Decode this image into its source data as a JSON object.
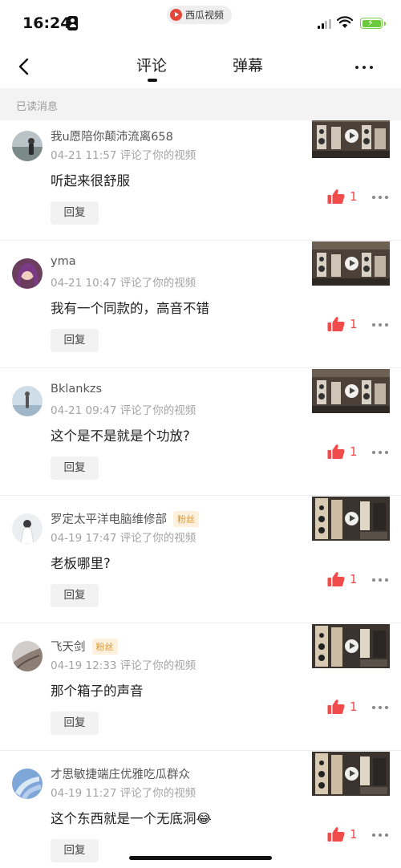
{
  "status_bar": {
    "time": "16:24",
    "app_name": "西瓜视频"
  },
  "nav": {
    "tabs": [
      {
        "label": "评论",
        "active": true
      },
      {
        "label": "弹幕",
        "active": false
      }
    ]
  },
  "section_header": "已读消息",
  "comments": [
    {
      "username": "我u愿陪你颠沛流离658",
      "badge": "",
      "meta": "04-21 11:57 评论了你的视频",
      "text": "听起来很舒服",
      "reply_label": "回复",
      "likes": "1"
    },
    {
      "username": "yma",
      "badge": "",
      "meta": "04-21 10:47 评论了你的视频",
      "text": "我有一个同款的，高音不错",
      "reply_label": "回复",
      "likes": "1"
    },
    {
      "username": "Bklankzs",
      "badge": "",
      "meta": "04-21 09:47 评论了你的视频",
      "text": "这个是不是就是个功放?",
      "reply_label": "回复",
      "likes": "1"
    },
    {
      "username": "罗定太平洋电脑维修部",
      "badge": "粉丝",
      "meta": "04-19 17:47 评论了你的视频",
      "text": "老板哪里?",
      "reply_label": "回复",
      "likes": "1"
    },
    {
      "username": "飞天剑",
      "badge": "粉丝",
      "meta": "04-19 12:33 评论了你的视频",
      "text": "那个箱子的声音",
      "reply_label": "回复",
      "likes": "1"
    },
    {
      "username": "才思敏捷端庄优雅吃瓜群众",
      "badge": "",
      "meta": "04-19 11:27 评论了你的视频",
      "text": "这个东西就是一个无底洞😂",
      "reply_label": "回复",
      "likes": "1"
    }
  ],
  "colors": {
    "like_red": "#f14b4b",
    "fan_badge": "#d8962c",
    "section_bg": "#f3f3f3"
  }
}
